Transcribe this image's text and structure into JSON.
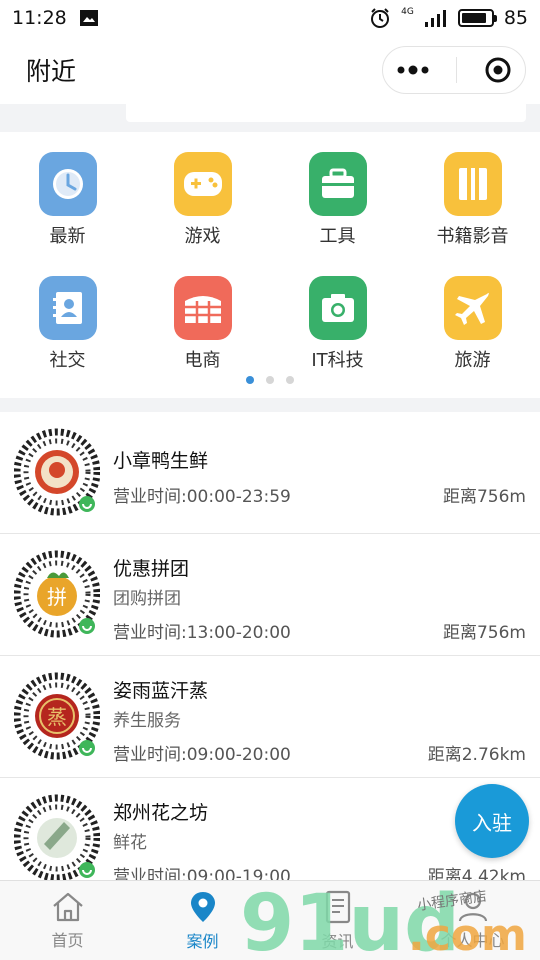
{
  "status_bar": {
    "time": "11:28",
    "network": "4G",
    "battery": "85"
  },
  "nav": {
    "title": "附近"
  },
  "categories": [
    {
      "label": "最新",
      "icon": "clock-icon",
      "color": "#6aa6e0"
    },
    {
      "label": "游戏",
      "icon": "gamepad-icon",
      "color": "#f8c13c"
    },
    {
      "label": "工具",
      "icon": "toolbox-icon",
      "color": "#38b06a"
    },
    {
      "label": "书籍影音",
      "icon": "book-icon",
      "color": "#f8c13c"
    },
    {
      "label": "社交",
      "icon": "contacts-icon",
      "color": "#6aa6e0"
    },
    {
      "label": "电商",
      "icon": "store-icon",
      "color": "#f06a5a"
    },
    {
      "label": "IT科技",
      "icon": "camera-icon",
      "color": "#38b06a"
    },
    {
      "label": "旅游",
      "icon": "airplane-icon",
      "color": "#f8c13c"
    }
  ],
  "pager": {
    "count": 3,
    "active": 0
  },
  "stores": [
    {
      "name": "小章鸭生鲜",
      "category": "",
      "hours_label": "营业时间:",
      "hours": "00:00-23:59",
      "distance": "距离756m",
      "logo_color": "#d4472a"
    },
    {
      "name": "优惠拼团",
      "category": "团购拼团",
      "hours_label": "营业时间:",
      "hours": "13:00-20:00",
      "distance": "距离756m",
      "logo_color": "#e9a52a"
    },
    {
      "name": "姿雨蓝汗蒸",
      "category": "养生服务",
      "hours_label": "营业时间:",
      "hours": "09:00-20:00",
      "distance": "距离2.76km",
      "logo_color": "#b5261e"
    },
    {
      "name": "郑州花之坊",
      "category": "鲜花",
      "hours_label": "营业时间:",
      "hours": "09:00-19:00",
      "distance": "距离4.42km",
      "logo_color": "#8aa88a"
    }
  ],
  "fab": {
    "label": "入驻"
  },
  "tabs": [
    {
      "label": "首页",
      "icon": "home-icon",
      "active": false
    },
    {
      "label": "案例",
      "icon": "location-pin-icon",
      "active": true
    },
    {
      "label": "资讯",
      "icon": "document-icon",
      "active": false
    },
    {
      "label": "个人中心",
      "icon": "user-icon",
      "active": false
    }
  ],
  "watermark": {
    "text": "91ud",
    "suffix": ".com",
    "tagline": "小程序商店"
  },
  "colors": {
    "accent": "#1a9ad8",
    "tab_active": "#1a86c8",
    "pager_active": "#3a8fd8"
  }
}
